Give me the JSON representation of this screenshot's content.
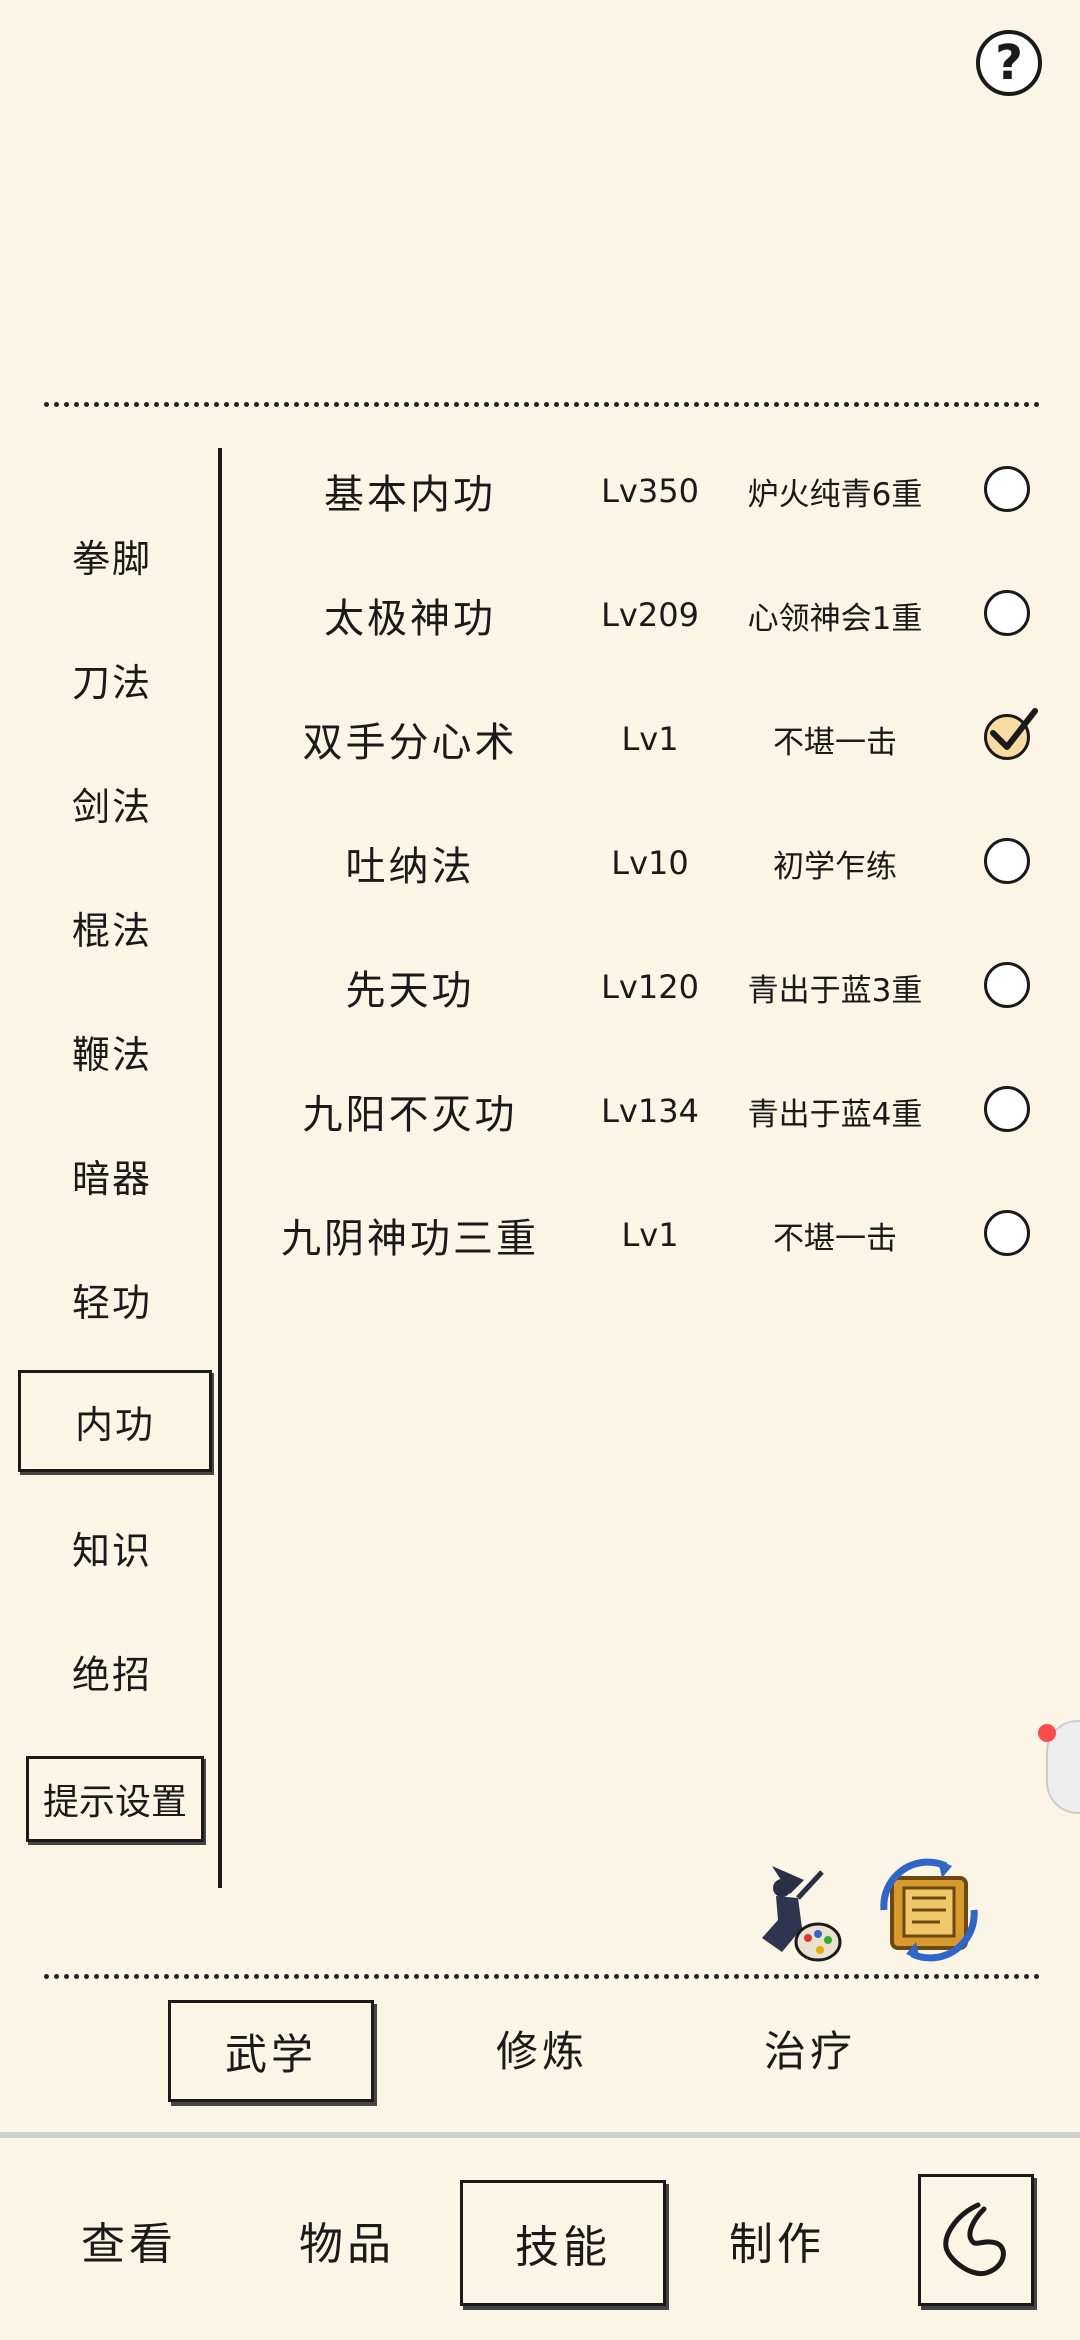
{
  "help": {
    "label": "?"
  },
  "categories": [
    "拳脚",
    "刀法",
    "剑法",
    "棍法",
    "鞭法",
    "暗器",
    "轻功",
    "内功",
    "知识",
    "绝招"
  ],
  "active_category": "内功",
  "hint_settings_label": "提示设置",
  "skills": [
    {
      "name": "基本内功",
      "level": "Lv350",
      "state": "炉火纯青6重",
      "checked": false
    },
    {
      "name": "太极神功",
      "level": "Lv209",
      "state": "心领神会1重",
      "checked": false
    },
    {
      "name": "双手分心术",
      "level": "Lv1",
      "state": "不堪一击",
      "checked": true
    },
    {
      "name": "吐纳法",
      "level": "Lv10",
      "state": "初学乍练",
      "checked": false
    },
    {
      "name": "先天功",
      "level": "Lv120",
      "state": "青出于蓝3重",
      "checked": false
    },
    {
      "name": "九阳不灭功",
      "level": "Lv134",
      "state": "青出于蓝4重",
      "checked": false
    },
    {
      "name": "九阴神功三重",
      "level": "Lv1",
      "state": "不堪一击",
      "checked": false
    }
  ],
  "subtabs": [
    "武学",
    "修炼",
    "治疗"
  ],
  "active_subtab": "武学",
  "nav": [
    "查看",
    "物品",
    "技能",
    "制作"
  ],
  "active_nav": "技能",
  "icons": {
    "martial_art_icon": "swordsman-palette-icon",
    "refresh_icon": "scroll-refresh-icon",
    "back_icon": "back-curve-icon"
  }
}
